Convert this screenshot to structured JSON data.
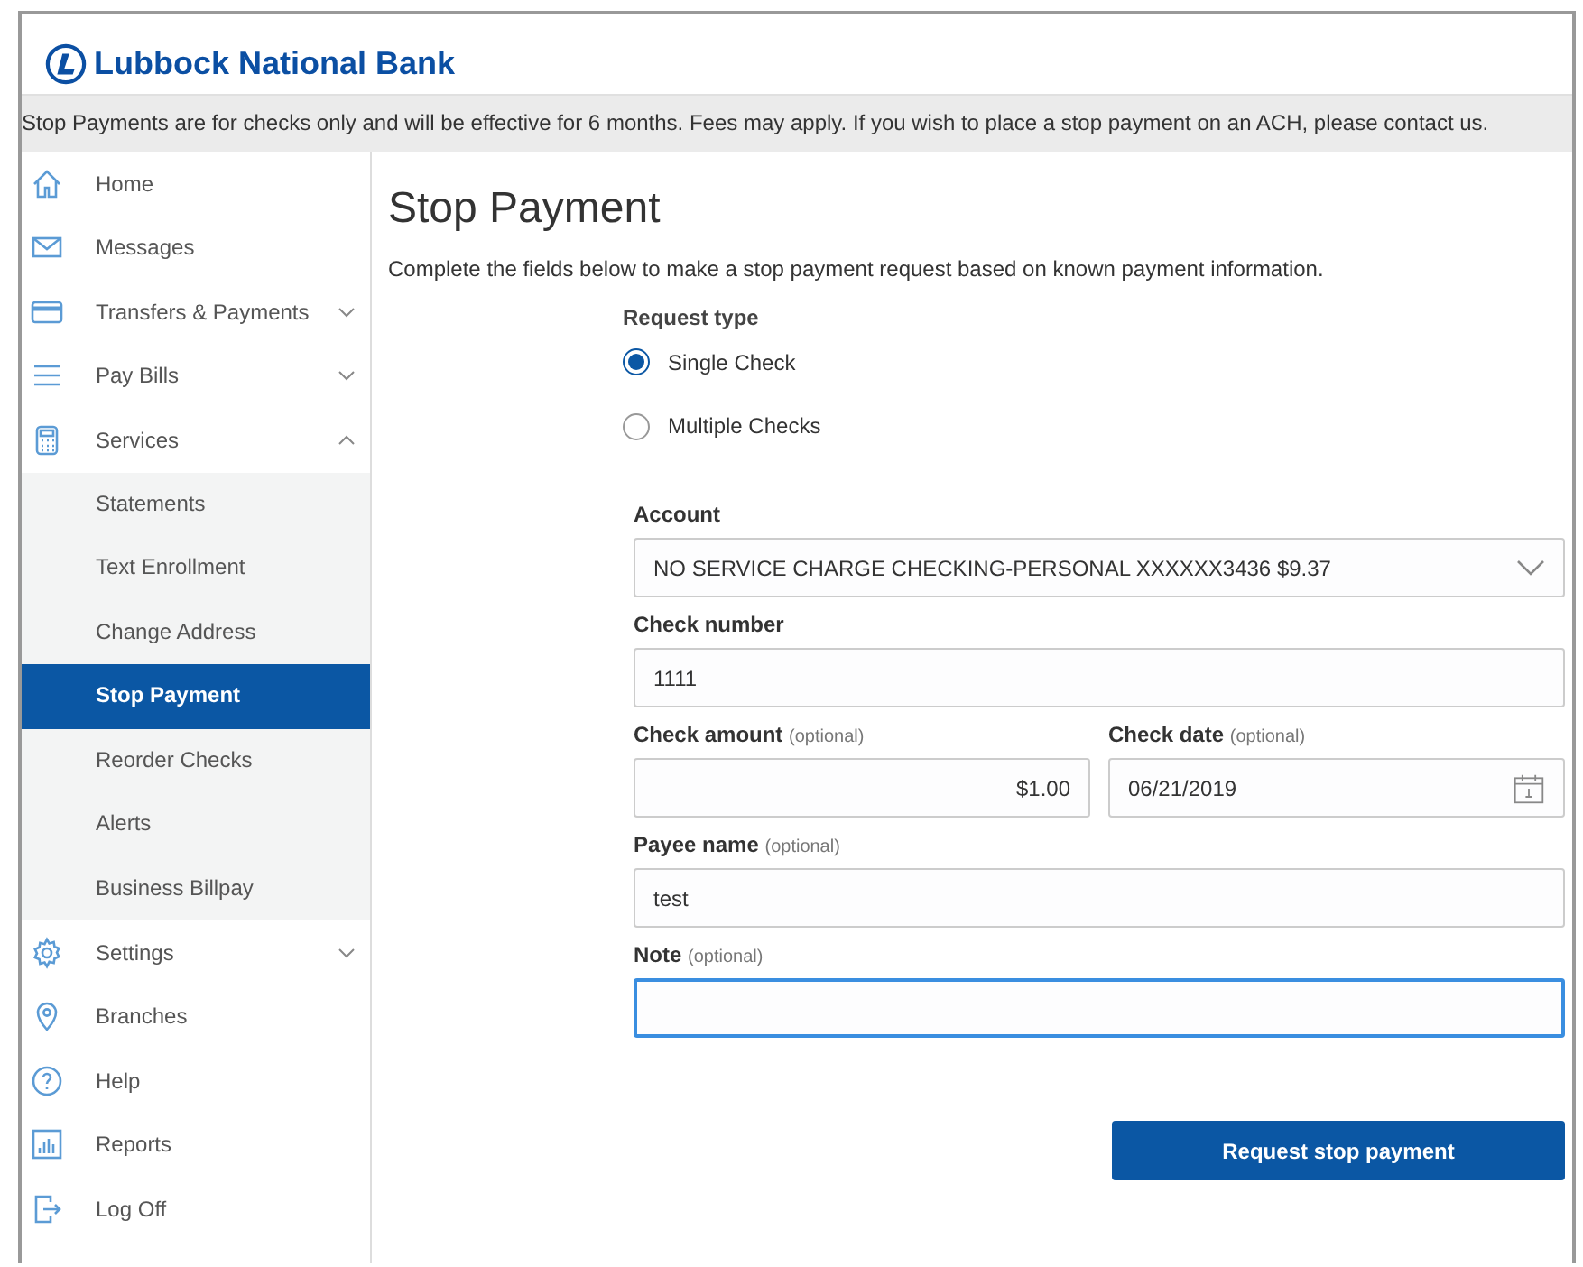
{
  "brand": {
    "name": "Lubbock National Bank"
  },
  "notice": "Stop Payments are for checks only and will be effective for 6 months. Fees may apply. If you wish to place a stop payment on an ACH, please contact us.",
  "sidebar": {
    "items": [
      {
        "label": "Home",
        "selected": false
      },
      {
        "label": "Messages",
        "selected": false
      },
      {
        "label": "Transfers & Payments",
        "selected": false,
        "expanded": false
      },
      {
        "label": "Pay Bills",
        "selected": false,
        "expanded": false
      },
      {
        "label": "Services",
        "selected": false,
        "expanded": true,
        "children": [
          {
            "label": "Statements",
            "selected": false
          },
          {
            "label": "Text Enrollment",
            "selected": false
          },
          {
            "label": "Change Address",
            "selected": false
          },
          {
            "label": "Stop Payment",
            "selected": true
          },
          {
            "label": "Reorder Checks",
            "selected": false
          },
          {
            "label": "Alerts",
            "selected": false
          },
          {
            "label": "Business Billpay",
            "selected": false
          }
        ]
      },
      {
        "label": "Settings",
        "selected": false,
        "expanded": false
      },
      {
        "label": "Branches",
        "selected": false
      },
      {
        "label": "Help",
        "selected": false
      },
      {
        "label": "Reports",
        "selected": false
      },
      {
        "label": "Log Off",
        "selected": false
      }
    ]
  },
  "page": {
    "title": "Stop Payment",
    "intro": "Complete the fields below to make a stop payment request based on known payment information."
  },
  "request_type": {
    "label": "Request type",
    "options": [
      {
        "label": "Single Check",
        "selected": true
      },
      {
        "label": "Multiple Checks",
        "selected": false
      }
    ]
  },
  "fields": [
    {
      "kind": "select",
      "label": "Account",
      "value": "NO SERVICE CHARGE CHECKING-PERSONAL XXXXXX3436 $9.37"
    },
    {
      "kind": "text",
      "label": "Check number",
      "value": "1111"
    },
    {
      "kind": "pair",
      "items": [
        {
          "kind": "amount",
          "label": "Check amount",
          "note": "(optional)",
          "value": "$1.00"
        },
        {
          "kind": "date",
          "label": "Check date",
          "note": "(optional)",
          "value": "06/21/2019"
        }
      ]
    },
    {
      "kind": "text",
      "label": "Payee name",
      "note": "(optional)",
      "value": "test"
    },
    {
      "kind": "text",
      "label": "Note",
      "note": "(optional)",
      "focused": true
    }
  ],
  "submit": "Request stop payment"
}
